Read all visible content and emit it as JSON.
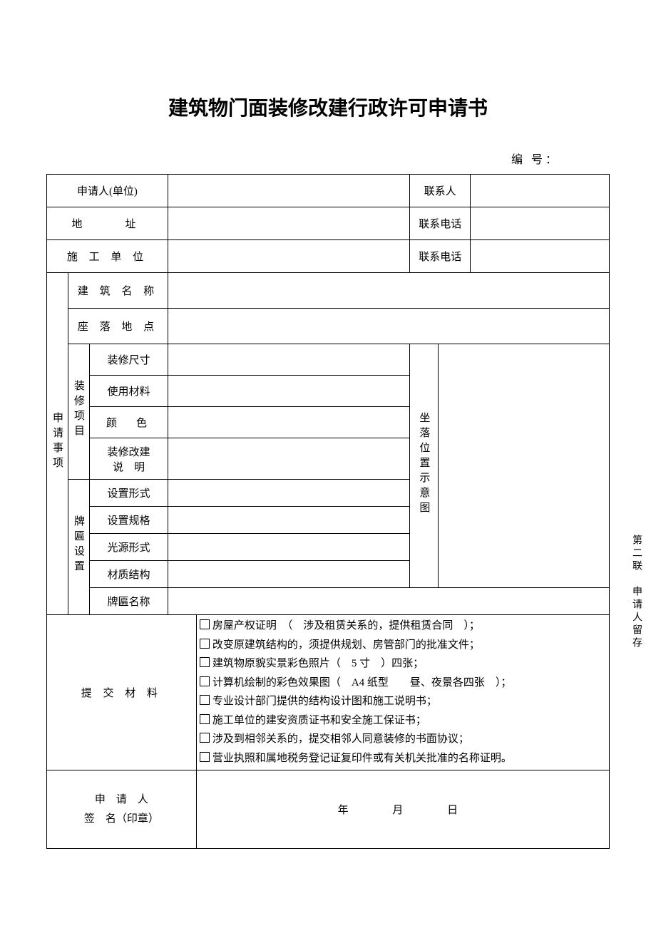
{
  "title": "建筑物门面装修改建行政许可申请书",
  "serial_label": "编 号：",
  "labels": {
    "applicant": "申请人(单位)",
    "contact": "联系人",
    "address": "地　　址",
    "phone": "联系电话",
    "builder": "施 工 单 位",
    "phone2": "联系电话",
    "matters": "申请事项",
    "building_name": "建 筑 名 称",
    "location": "座 落 地 点",
    "renov_proj": "装修项目",
    "renov_size": "装修尺寸",
    "materials_used": "使用材料",
    "color": "颜　色",
    "renov_desc1": "装修改建",
    "renov_desc2": "说　明",
    "signboard": "牌匾设置",
    "set_form": "设置形式",
    "set_spec": "设置规格",
    "light_form": "光源形式",
    "mat_struct": "材质结构",
    "sign_name": "牌匾名称",
    "diagram": "坐落位置示意图",
    "submit_mat": "提 交 材 料",
    "sig1": "申　请　人",
    "sig2": "签　名（印章）",
    "year": "年",
    "month": "月",
    "day": "日"
  },
  "values": {
    "applicant": "",
    "contact": "",
    "address": "",
    "phone": "",
    "builder": "",
    "phone2": "",
    "building_name": "",
    "location": "",
    "renov_size": "",
    "materials_used": "",
    "color": "",
    "renov_desc": "",
    "set_form": "",
    "set_spec": "",
    "light_form": "",
    "mat_struct": "",
    "sign_name": "",
    "diagram": ""
  },
  "materials_list": [
    "房屋产权证明　（　涉及租赁关系的，提供租赁合同　）；",
    "改变原建筑结构的，须提供规划、房管部门的批准文件；",
    "建筑物原貌实景彩色照片（　5 寸　）四张；",
    "计算机绘制的彩色效果图（　A4 纸型　　昼、夜景各四张　）；",
    "专业设计部门提供的结构设计图和施工说明书；",
    "施工单位的建安资质证书和安全施工保证书；",
    "涉及到相邻关系的，提交相邻人同意装修的书面协议；",
    "营业执照和属地税务登记证复印件或有关机关批准的名称证明。"
  ],
  "side_note": "第二联　申请人留存"
}
